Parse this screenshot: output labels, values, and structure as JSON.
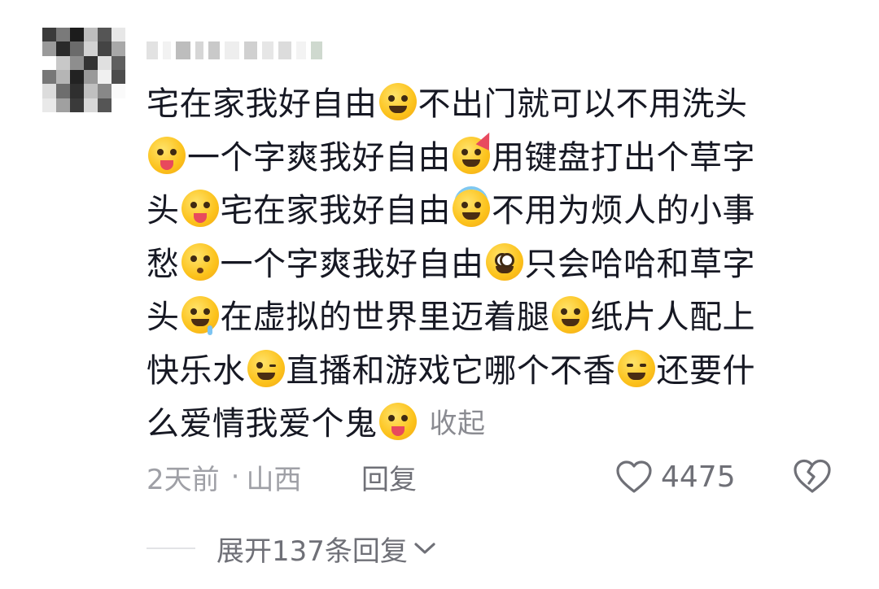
{
  "comment": {
    "lines": [
      [
        {
          "t": "宅在家我好自由"
        },
        {
          "e": "grin-squint"
        },
        {
          "t": "不出门就可以不用洗头"
        }
      ],
      [
        {
          "e": "tongue-squint"
        },
        {
          "t": "一个字爽我好自由"
        },
        {
          "e": "party"
        },
        {
          "t": "用键盘打出个草字"
        }
      ],
      [
        {
          "t": "头"
        },
        {
          "e": "zany"
        },
        {
          "t": "宅在家我好自由"
        },
        {
          "e": "halo"
        },
        {
          "t": "不用为烦人的小事"
        }
      ],
      [
        {
          "t": "愁"
        },
        {
          "e": "kissing"
        },
        {
          "t": "一个字爽我好自由"
        },
        {
          "e": "nerd"
        },
        {
          "t": "只会哈哈和草字"
        }
      ],
      [
        {
          "t": "头"
        },
        {
          "e": "drooling"
        },
        {
          "t": "在虚拟的世界里迈着腿"
        },
        {
          "e": "grimace"
        },
        {
          "t": "纸片人配上"
        }
      ],
      [
        {
          "t": "快乐水"
        },
        {
          "e": "wink"
        },
        {
          "t": "直播和游戏它哪个不香"
        },
        {
          "e": "woozy"
        },
        {
          "t": "还要什"
        }
      ],
      [
        {
          "t": "么爱情我爱个鬼"
        },
        {
          "e": "yum"
        }
      ]
    ],
    "collapse_label": "收起"
  },
  "meta": {
    "time": "2天前",
    "separator": "·",
    "location": "山西"
  },
  "actions": {
    "reply_label": "回复",
    "like_count": "4475"
  },
  "replies": {
    "expand_label": "展开137条回复"
  },
  "colors": {
    "text": "#161823",
    "muted": "#9fa0a6",
    "action": "#6f7077"
  }
}
